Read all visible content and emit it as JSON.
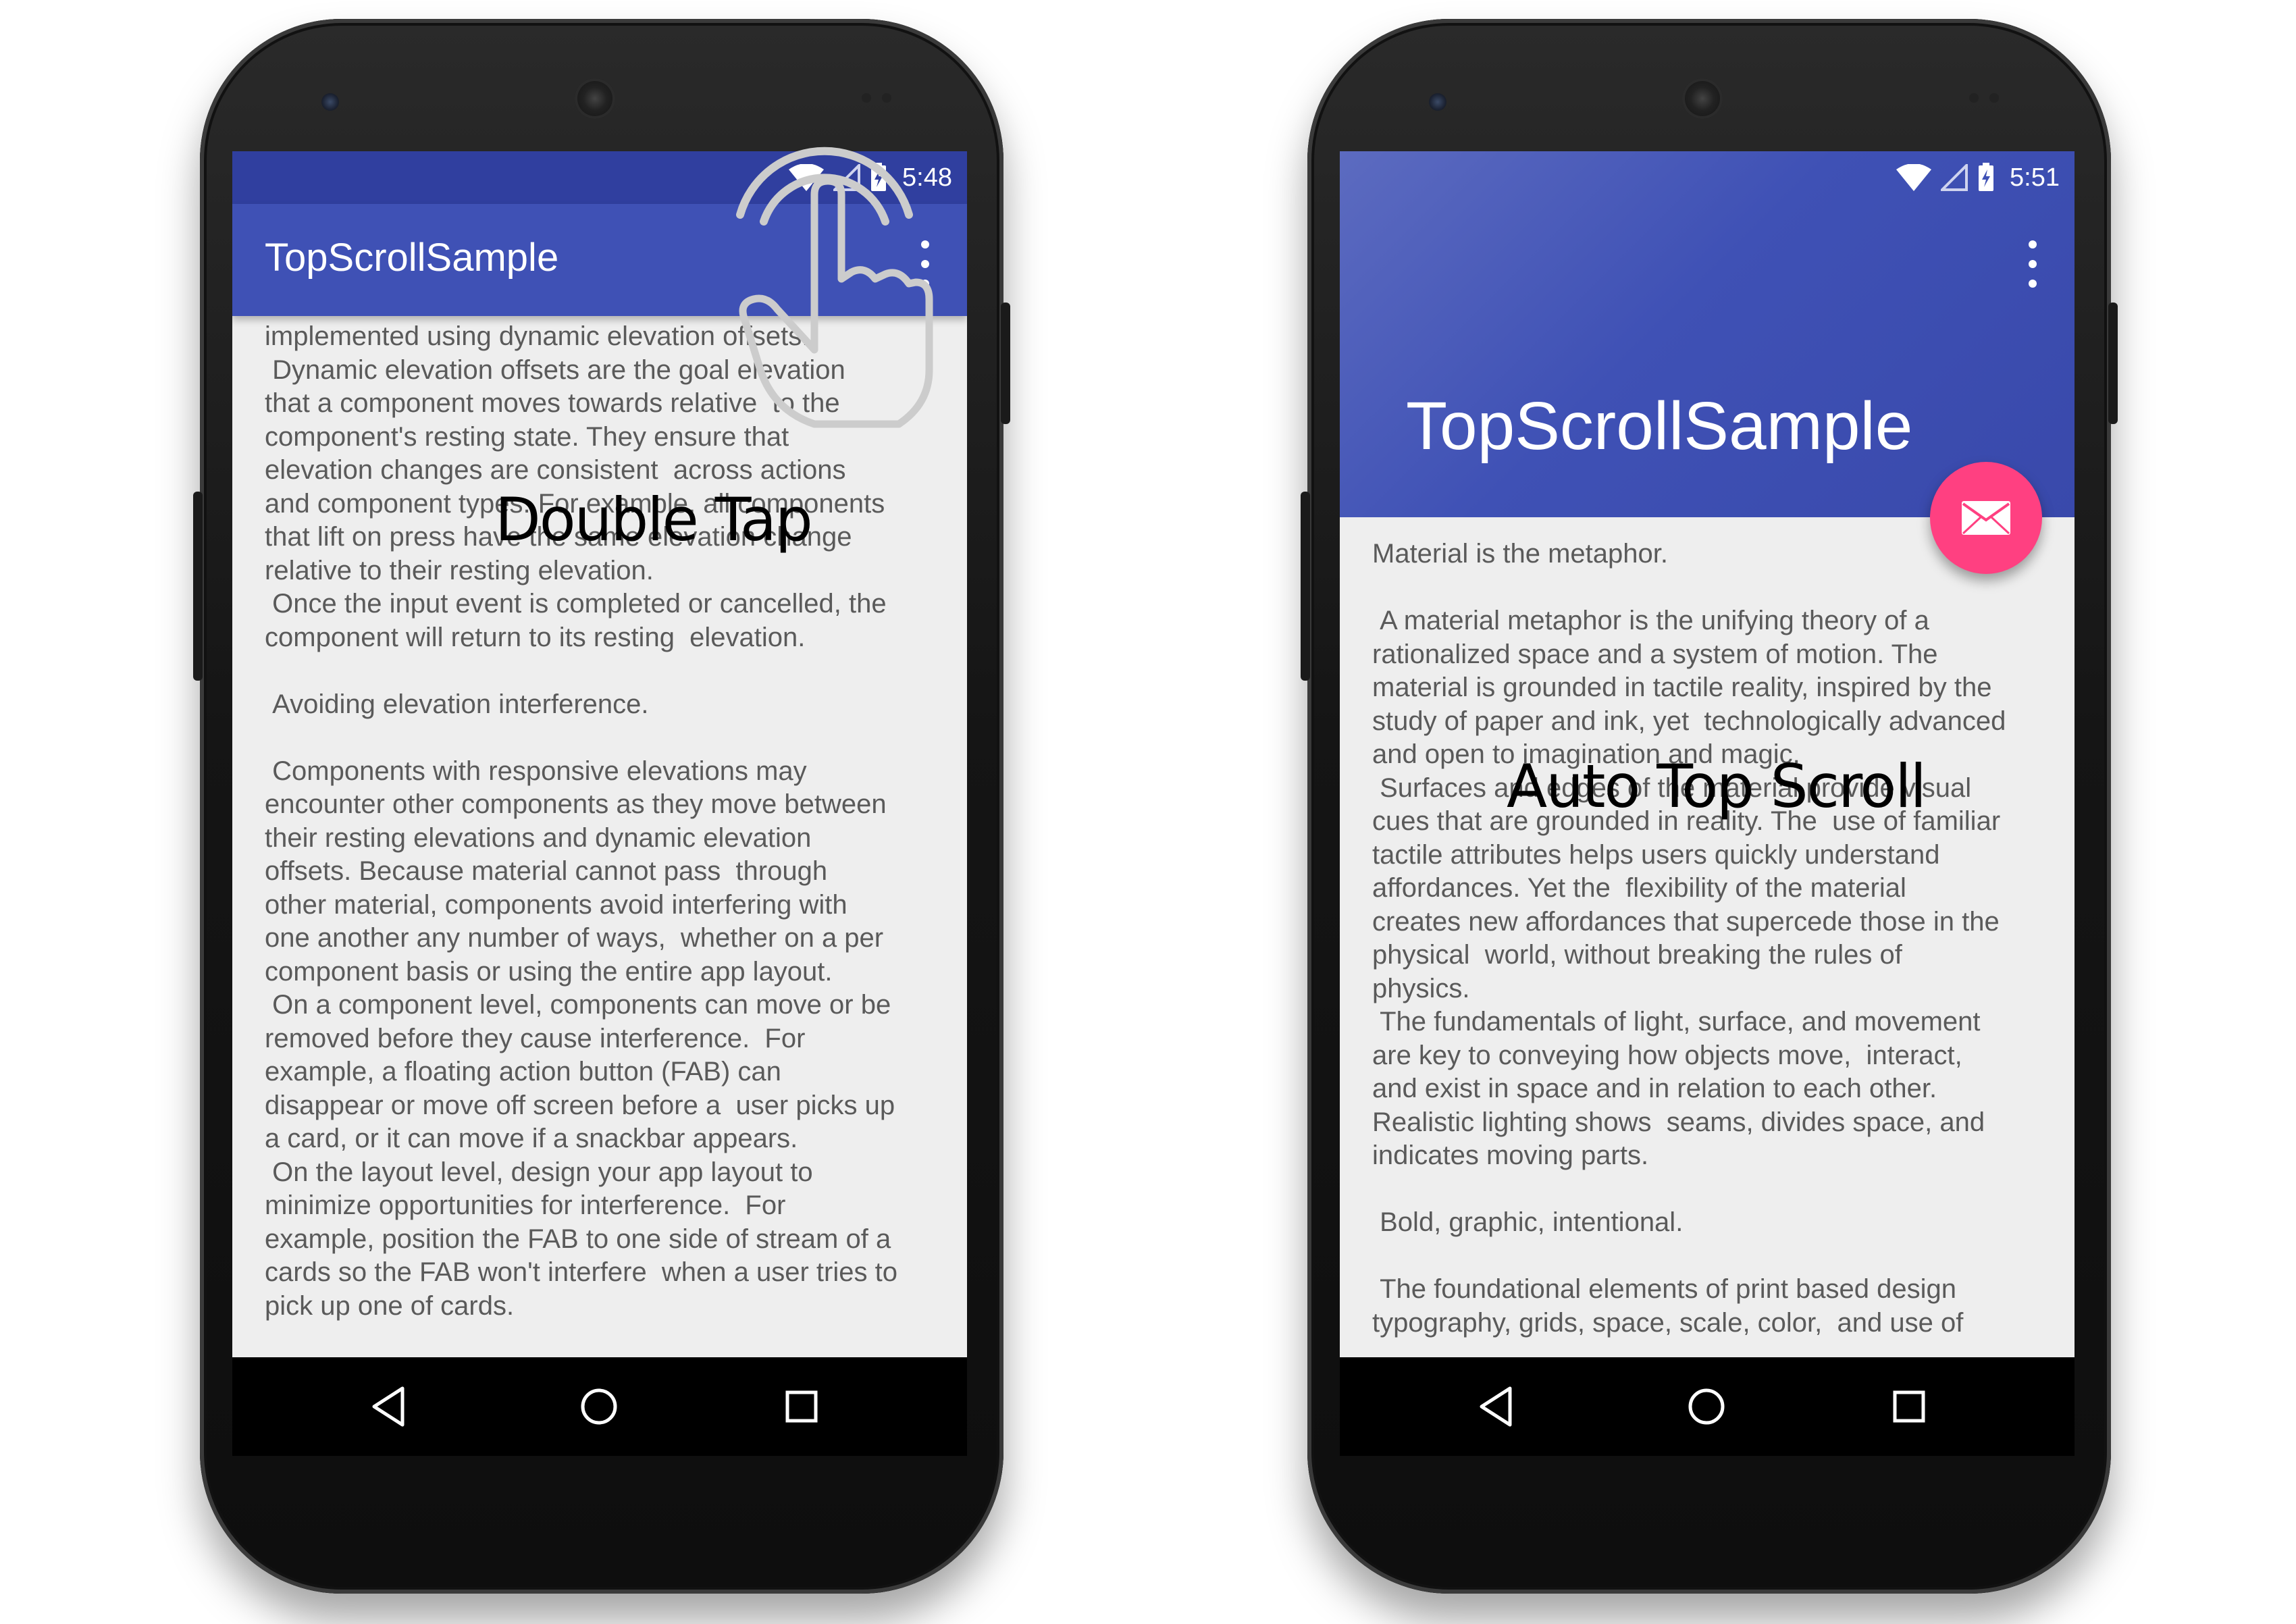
{
  "left_phone": {
    "status_time": "5:48",
    "app_title": "TopScrollSample",
    "content_text": "implemented using dynamic elevation offsets.\n Dynamic elevation offsets are the goal elevation\nthat a component moves towards relative  to the\ncomponent's resting state. They ensure that\nelevation changes are consistent  across actions\nand component types. For example, all components\nthat lift on press have the same elevation change\nrelative to their resting elevation.\n Once the input event is completed or cancelled, the\ncomponent will return to its resting  elevation.\n\n Avoiding elevation interference.\n\n Components with responsive elevations may\nencounter other components as they move between\ntheir resting elevations and dynamic elevation\noffsets. Because material cannot pass  through\nother material, components avoid interfering with\none another any number of ways,  whether on a per\ncomponent basis or using the entire app layout.\n On a component level, components can move or be\nremoved before they cause interference.  For\nexample, a floating action button (FAB) can\ndisappear or move off screen before a  user picks up\na card, or it can move if a snackbar appears.\n On the layout level, design your app layout to\nminimize opportunities for interference.  For\nexample, position the FAB to one side of stream of a\ncards so the FAB won't interfere  when a user tries to\npick up one of cards.",
    "gesture_label": "Double Tap",
    "gesture_icon": "tap-hand-icon"
  },
  "right_phone": {
    "status_time": "5:51",
    "app_title": "TopScrollSample",
    "fab_icon": "mail-icon",
    "content_text": "Material is the metaphor.\n\n A material metaphor is the unifying theory of a\nrationalized space and a system of motion. The\nmaterial is grounded in tactile reality, inspired by the\nstudy of paper and ink, yet  technologically advanced\nand open to imagination and magic.\n Surfaces and edges of the material provide visual\ncues that are grounded in reality. The  use of familiar\ntactile attributes helps users quickly understand\naffordances. Yet the  flexibility of the material\ncreates new affordances that supercede those in the\nphysical  world, without breaking the rules of\nphysics.\n The fundamentals of light, surface, and movement\nare key to conveying how objects move,  interact,\nand exist in space and in relation to each other.\nRealistic lighting shows  seams, divides space, and\nindicates moving parts.\n\n Bold, graphic, intentional.\n\n The foundational elements of print based design\ntypography, grids, space, scale, color,  and use of",
    "gesture_label": "Auto Top Scroll"
  },
  "colors": {
    "primary": "#3f51b5",
    "primary_dark": "#303f9f",
    "accent": "#ff4081",
    "background": "#eeeeee",
    "text": "#5a5a5a"
  },
  "icons": {
    "wifi": "wifi-icon",
    "signal": "signal-icon",
    "battery": "battery-charging-icon",
    "overflow": "overflow-menu-icon",
    "back": "back-icon",
    "home": "home-icon",
    "recents": "recents-icon"
  }
}
